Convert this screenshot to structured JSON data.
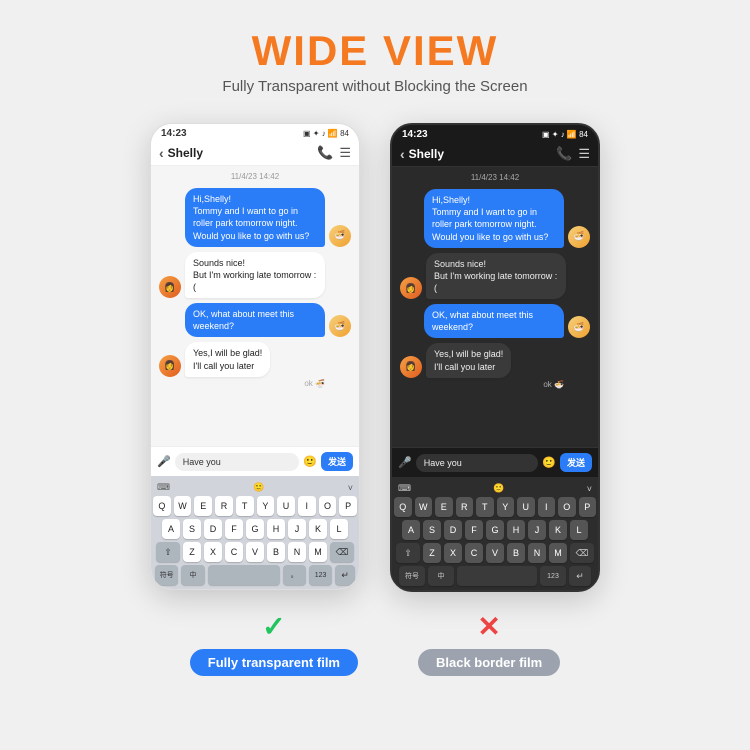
{
  "header": {
    "title": "WIDE VIEW",
    "subtitle": "Fully Transparent without Blocking the Screen"
  },
  "phones": [
    {
      "id": "phone-left",
      "type": "light",
      "status_time": "14:23",
      "status_icons": "🔋 ✦ 🔊 📶 84",
      "contact_name": "Shelly",
      "messages": [
        {
          "side": "right",
          "text": "Hi,Shelly!\nTommy and I want to go in roller park tomorrow night. Would you like to go with us?",
          "bubble": "blue",
          "has_avatar": true
        },
        {
          "side": "left",
          "text": "Sounds nice!\nBut I'm working late tomorrow :(",
          "bubble": "white",
          "has_avatar": true
        },
        {
          "side": "right",
          "text": "OK, what about meet this weekend?",
          "bubble": "blue",
          "has_avatar": true
        },
        {
          "side": "left",
          "text": "Yes,I will be glad!\nI'll call you later",
          "bubble": "white",
          "has_avatar": true
        }
      ],
      "ok_label": "ok",
      "input_placeholder": "Have you",
      "send_label": "发送",
      "keyboard_rows": [
        [
          "Q",
          "W",
          "E",
          "R",
          "T",
          "Y",
          "U",
          "I",
          "O",
          "P"
        ],
        [
          "A",
          "S",
          "D",
          "F",
          "G",
          "H",
          "J",
          "K",
          "L"
        ],
        [
          "⇧",
          "Z",
          "X",
          "C",
          "V",
          "B",
          "N",
          "M",
          "⌫"
        ],
        [
          "符号",
          "中",
          "_",
          "_SPACE_",
          "。",
          "123",
          "↵"
        ]
      ]
    },
    {
      "id": "phone-right",
      "type": "dark",
      "status_time": "14:23",
      "status_icons": "🔋 ✦ 🔊 📶 84",
      "contact_name": "Shelly",
      "messages": [
        {
          "side": "right",
          "text": "Hi,Shelly!\nTommy and I want to go in roller park tomorrow night. Would you like to go with us?",
          "bubble": "blue",
          "has_avatar": true
        },
        {
          "side": "left",
          "text": "Sounds nice!\nBut I'm working late tomorrow :(",
          "bubble": "white",
          "has_avatar": true
        },
        {
          "side": "right",
          "text": "OK, what about meet this weekend?",
          "bubble": "blue",
          "has_avatar": true
        },
        {
          "side": "left",
          "text": "Yes,I will be glad!\nI'll call you later",
          "bubble": "white",
          "has_avatar": true
        }
      ],
      "ok_label": "ok",
      "input_placeholder": "Have you",
      "send_label": "发送",
      "keyboard_rows": [
        [
          "Q",
          "W",
          "E",
          "R",
          "T",
          "Y",
          "U",
          "I",
          "O",
          "P"
        ],
        [
          "A",
          "S",
          "D",
          "F",
          "G",
          "H",
          "J",
          "K",
          "L"
        ],
        [
          "⇧",
          "Z",
          "X",
          "C",
          "V",
          "B",
          "N",
          "M",
          "⌫"
        ],
        [
          "符号",
          "中",
          "_SPACE_",
          "123",
          "↵"
        ]
      ]
    }
  ],
  "labels": [
    {
      "type": "check",
      "mark": "✓",
      "text": "Fully transparent film",
      "style": "blue"
    },
    {
      "type": "cross",
      "mark": "✕",
      "text": "Black border film",
      "style": "gray"
    }
  ]
}
